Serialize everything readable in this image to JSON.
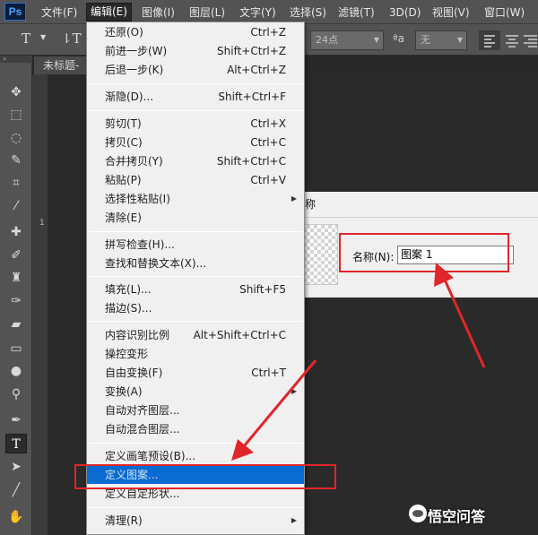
{
  "app": {
    "logo": "Ps"
  },
  "menubar": {
    "items": [
      "文件(F)",
      "编辑(E)",
      "图像(I)",
      "图层(L)",
      "文字(Y)",
      "选择(S)",
      "滤镜(T)",
      "3D(D)",
      "视图(V)",
      "窗口(W)"
    ]
  },
  "options": {
    "font_size": "24点",
    "antialias_label": "ªa",
    "antialias_value": "无"
  },
  "document": {
    "tab": "未标题-",
    "ruler_mark": "1"
  },
  "edit_menu": {
    "items": [
      {
        "label": "还原(O)",
        "shortcut": "Ctrl+Z"
      },
      {
        "label": "前进一步(W)",
        "shortcut": "Shift+Ctrl+Z"
      },
      {
        "label": "后退一步(K)",
        "shortcut": "Alt+Ctrl+Z"
      },
      {
        "label": "渐隐(D)...",
        "shortcut": "Shift+Ctrl+F"
      },
      {
        "label": "剪切(T)",
        "shortcut": "Ctrl+X"
      },
      {
        "label": "拷贝(C)",
        "shortcut": "Ctrl+C"
      },
      {
        "label": "合并拷贝(Y)",
        "shortcut": "Shift+Ctrl+C"
      },
      {
        "label": "粘贴(P)",
        "shortcut": "Ctrl+V"
      },
      {
        "label": "选择性粘贴(I)",
        "shortcut": ""
      },
      {
        "label": "清除(E)",
        "shortcut": ""
      },
      {
        "label": "拼写检查(H)...",
        "shortcut": ""
      },
      {
        "label": "查找和替换文本(X)...",
        "shortcut": ""
      },
      {
        "label": "填充(L)...",
        "shortcut": "Shift+F5"
      },
      {
        "label": "描边(S)...",
        "shortcut": ""
      },
      {
        "label": "内容识别比例",
        "shortcut": "Alt+Shift+Ctrl+C"
      },
      {
        "label": "操控变形",
        "shortcut": ""
      },
      {
        "label": "自由变换(F)",
        "shortcut": "Ctrl+T"
      },
      {
        "label": "变换(A)",
        "shortcut": ""
      },
      {
        "label": "自动对齐图层...",
        "shortcut": ""
      },
      {
        "label": "自动混合图层...",
        "shortcut": ""
      },
      {
        "label": "定义画笔预设(B)...",
        "shortcut": ""
      },
      {
        "label": "定义图案...",
        "shortcut": ""
      },
      {
        "label": "定义自定形状...",
        "shortcut": ""
      },
      {
        "label": "清理(R)",
        "shortcut": ""
      }
    ]
  },
  "dialog": {
    "title": "称",
    "name_label": "名称(N):",
    "name_value": "图案 1"
  },
  "watermark": {
    "text": "悟空问答"
  },
  "colors": {
    "highlight": "#0a6bd0",
    "annotation": "#e0262a"
  }
}
